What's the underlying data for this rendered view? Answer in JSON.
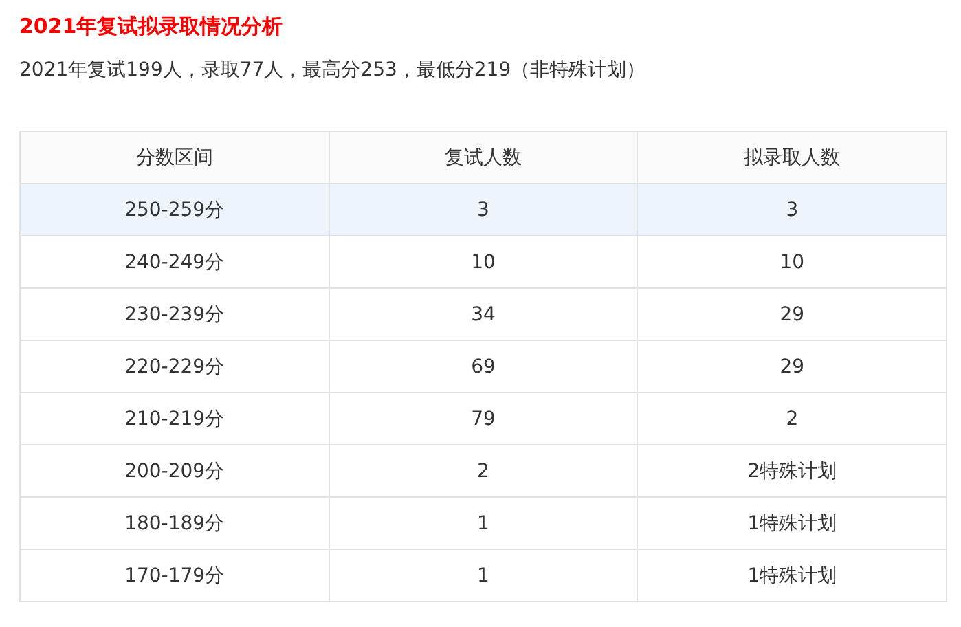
{
  "title": "2021年复试拟录取情况分析",
  "summary": "2021年复试199人，录取77人，最高分253，最低分219（非特殊计划）",
  "table": {
    "columns": [
      "分数区间",
      "复试人数",
      "拟录取人数"
    ],
    "rows": [
      {
        "cells": [
          "250-259分",
          "3",
          "3"
        ],
        "highlighted": true
      },
      {
        "cells": [
          "240-249分",
          "10",
          "10"
        ],
        "highlighted": false
      },
      {
        "cells": [
          "230-239分",
          "34",
          "29"
        ],
        "highlighted": false
      },
      {
        "cells": [
          "220-229分",
          "69",
          "29"
        ],
        "highlighted": false
      },
      {
        "cells": [
          "210-219分",
          "79",
          "2"
        ],
        "highlighted": false
      },
      {
        "cells": [
          "200-209分",
          "2",
          "2特殊计划"
        ],
        "highlighted": false
      },
      {
        "cells": [
          "180-189分",
          "1",
          "1特殊计划"
        ],
        "highlighted": false
      },
      {
        "cells": [
          "170-179分",
          "1",
          "1特殊计划"
        ],
        "highlighted": false
      }
    ]
  }
}
